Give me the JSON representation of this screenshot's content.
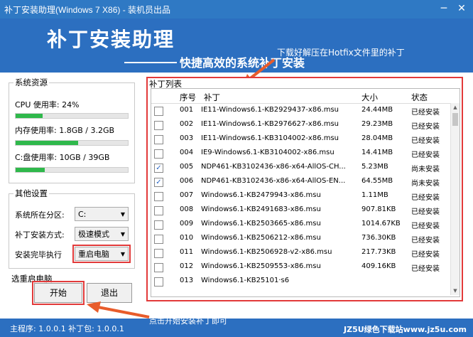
{
  "window": {
    "title": "补丁安装助理(Windows 7 X86) - 装机员出品",
    "minimize_glyph": "─",
    "close_glyph": "✕"
  },
  "banner": {
    "title": "补丁安装助理",
    "subtitle": "快捷高效的系统补丁安装",
    "hint": "下载好解压在Hotfix文件里的补丁"
  },
  "system": {
    "title": "系统资源",
    "cpu": {
      "label": "CPU 使用率: 24%",
      "percent": 24
    },
    "mem": {
      "label": "内存使用率: 1.8GB / 3.2GB",
      "percent": 56
    },
    "disk": {
      "label": "C:盘使用率: 10GB / 39GB",
      "percent": 26
    }
  },
  "settings": {
    "title": "其他设置",
    "partition_label": "系统所在分区:",
    "partition_value": "C:",
    "mode_label": "补丁安装方式:",
    "mode_value": "极速模式",
    "after_label": "安装完毕执行",
    "after_value": "重启电脑"
  },
  "reboot_label": "选重启电脑",
  "buttons": {
    "start": "开始",
    "exit": "退出"
  },
  "list": {
    "title": "补丁列表",
    "headers": [
      "序号",
      "补丁",
      "大小",
      "状态"
    ],
    "rows": [
      {
        "checked": false,
        "no": "001",
        "name": "IE11-Windows6.1-KB2929437-x86.msu",
        "size": "24.44MB",
        "status": "已经安装"
      },
      {
        "checked": false,
        "no": "002",
        "name": "IE11-Windows6.1-KB2976627-x86.msu",
        "size": "29.23MB",
        "status": "已经安装"
      },
      {
        "checked": false,
        "no": "003",
        "name": "IE11-Windows6.1-KB3104002-x86.msu",
        "size": "28.04MB",
        "status": "已经安装"
      },
      {
        "checked": false,
        "no": "004",
        "name": "IE9-Windows6.1-KB3104002-x86.msu",
        "size": "14.41MB",
        "status": "已经安装"
      },
      {
        "checked": true,
        "no": "005",
        "name": "NDP461-KB3102436-x86-x64-AllOS-CH...",
        "size": "5.23MB",
        "status": "尚未安装"
      },
      {
        "checked": true,
        "no": "006",
        "name": "NDP461-KB3102436-x86-x64-AllOS-EN...",
        "size": "64.55MB",
        "status": "尚未安装"
      },
      {
        "checked": false,
        "no": "007",
        "name": "Windows6.1-KB2479943-x86.msu",
        "size": "1.11MB",
        "status": "已经安装"
      },
      {
        "checked": false,
        "no": "008",
        "name": "Windows6.1-KB2491683-x86.msu",
        "size": "907.81KB",
        "status": "已经安装"
      },
      {
        "checked": false,
        "no": "009",
        "name": "Windows6.1-KB2503665-x86.msu",
        "size": "1014.67KB",
        "status": "已经安装"
      },
      {
        "checked": false,
        "no": "010",
        "name": "Windows6.1-KB2506212-x86.msu",
        "size": "736.30KB",
        "status": "已经安装"
      },
      {
        "checked": false,
        "no": "011",
        "name": "Windows6.1-KB2506928-v2-x86.msu",
        "size": "217.73KB",
        "status": "已经安装"
      },
      {
        "checked": false,
        "no": "012",
        "name": "Windows6.1-KB2509553-x86.msu",
        "size": "409.16KB",
        "status": "已经安装"
      },
      {
        "checked": false,
        "no": "013",
        "name": "Windows6.1-KB25101·s6",
        "size": "",
        "status": ""
      }
    ]
  },
  "bottom_hint": "点击开始安装补丁即可",
  "status": {
    "text": "主程序: 1.0.0.1 补丁包: 1.0.0.1"
  },
  "watermark": "JZ5U绿色下载站www.jz5u.com",
  "colors": {
    "accent": "#2c6fc0",
    "highlight": "#e23a3a",
    "bar": "#2fb84b"
  }
}
